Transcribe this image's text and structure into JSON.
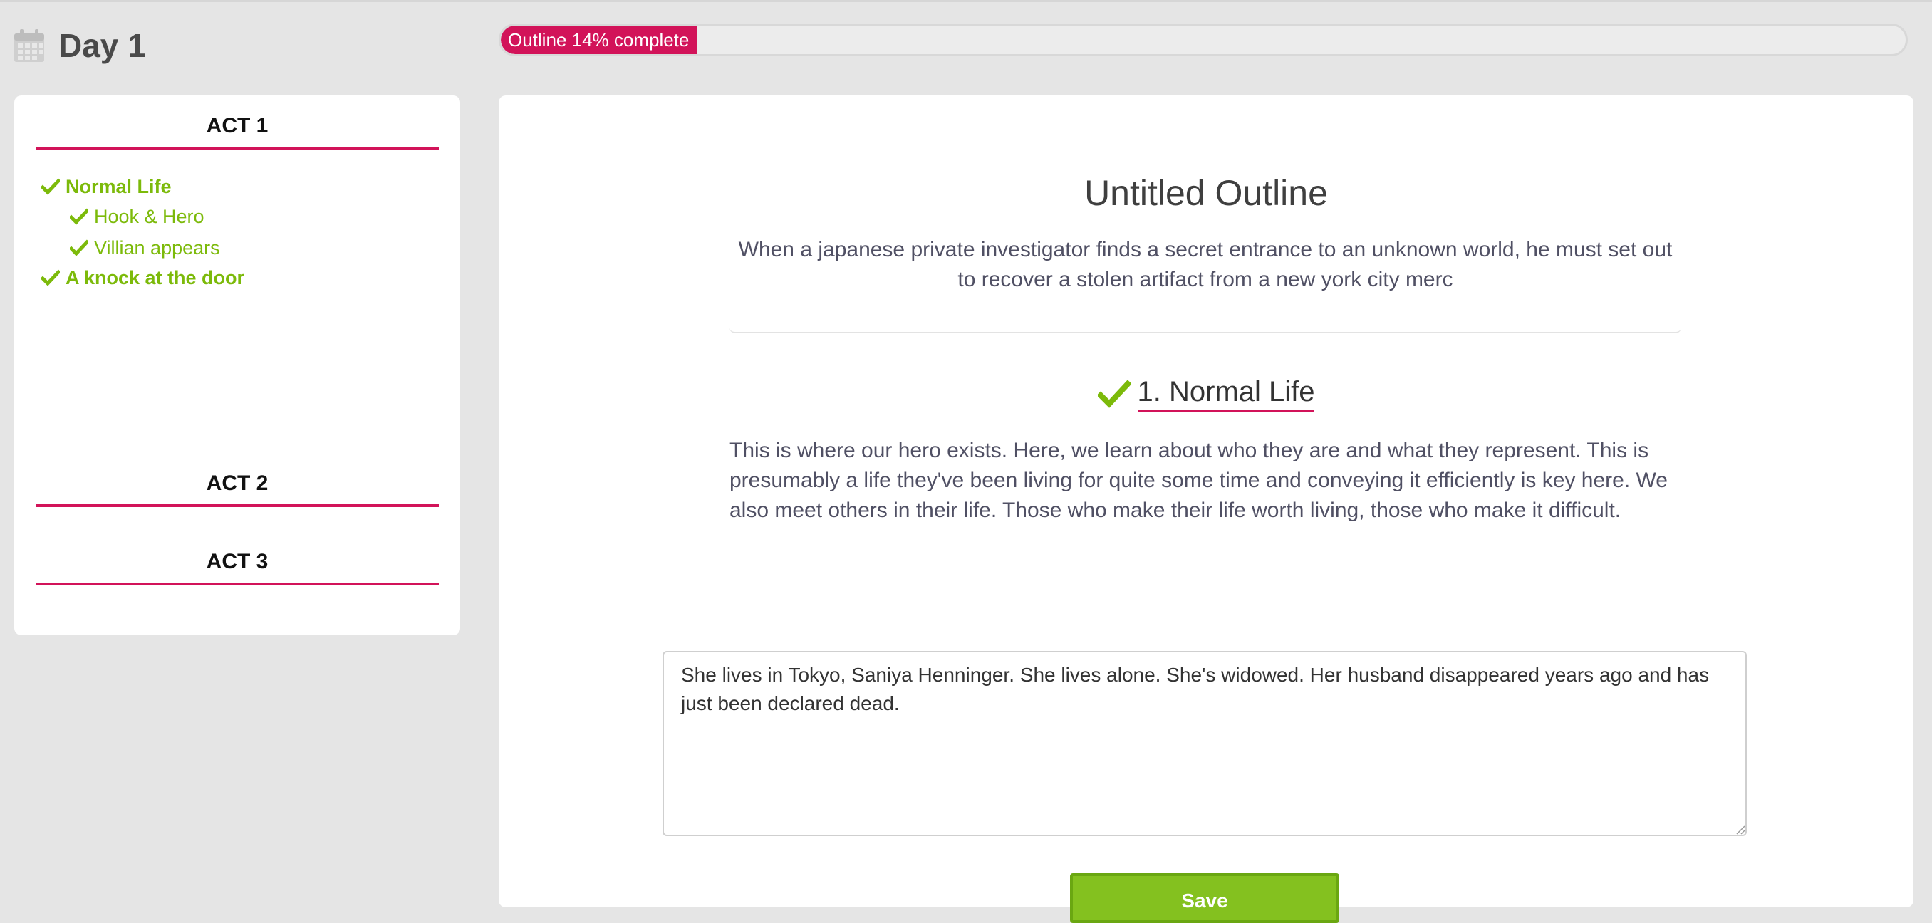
{
  "header": {
    "title": "Day 1",
    "icon": "calendar-icon"
  },
  "progress": {
    "label": "Outline 14% complete",
    "percent": 14,
    "color": "#d21359"
  },
  "sidebar": {
    "acts": [
      {
        "title": "ACT 1",
        "beats": [
          {
            "label": "Normal Life",
            "level": "main",
            "done": true
          },
          {
            "label": "Hook & Hero",
            "level": "sub",
            "done": true
          },
          {
            "label": "Villian appears",
            "level": "sub",
            "done": true
          },
          {
            "label": "A knock at the door",
            "level": "main",
            "done": true
          }
        ]
      },
      {
        "title": "ACT 2",
        "beats": []
      },
      {
        "title": "ACT 3",
        "beats": []
      }
    ]
  },
  "main": {
    "outline_title": "Untitled Outline",
    "premise": "When a japanese private investigator finds a secret entrance to an unknown world, he must set out to recover a stolen artifact from a new york city merc",
    "beat_heading": "1. Normal Life",
    "beat_description": "This is where our hero exists. Here, we learn about who they are and what they represent. This is presumably a life they've been living for quite some time and conveying it efficiently is key here. We also meet others in their life. Those who make their life worth living, those who make it difficult.",
    "notes_value": "She lives in Tokyo, Saniya Henninger. She lives alone. She's widowed. Her husband disappeared years ago and has just been declared dead.",
    "save_label": "Save"
  },
  "colors": {
    "accent": "#d21359",
    "success": "#7cba0a",
    "button": "#84c11f"
  }
}
